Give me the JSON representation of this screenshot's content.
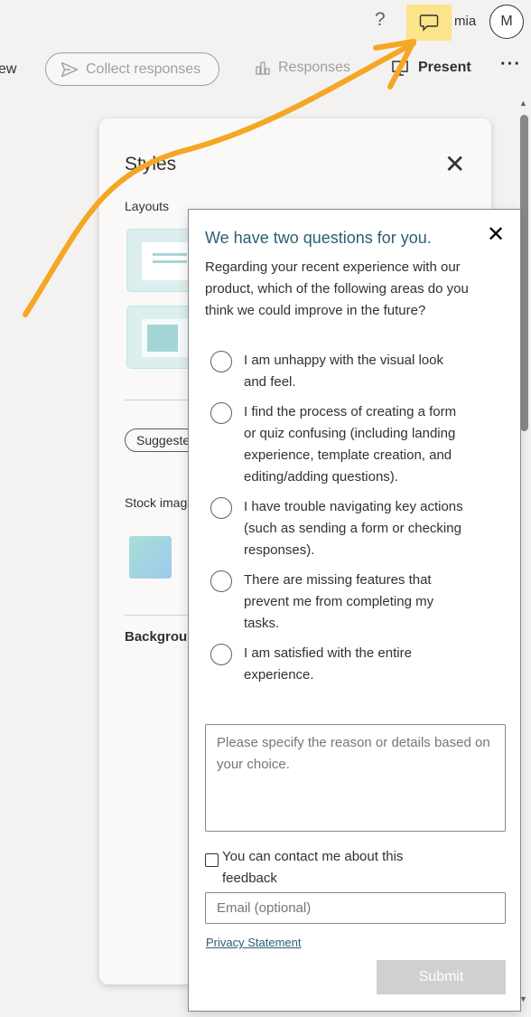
{
  "topbar": {
    "help_icon": "?",
    "feedback_icon": "chat-bubble-icon",
    "user_name": "mia",
    "avatar_initial": "M",
    "highlight_color": "#fbe48a"
  },
  "toolbar": {
    "view_label": "ew",
    "collect_label": "Collect responses",
    "responses_label": "Responses",
    "present_label": "Present",
    "more_label": "···"
  },
  "styles_panel": {
    "title": "Styles",
    "layouts_label": "Layouts",
    "suggested_label": "Suggested",
    "stock_label": "Stock images",
    "background_label": "Background"
  },
  "dialog": {
    "title": "We have two questions for you.",
    "question": "Regarding your recent experience with our product, which of the following areas do you think we could improve in the future?",
    "options": [
      "I am unhappy with the visual look and feel.",
      "I find the process of creating a form or quiz confusing (including landing experience, template creation, and editing/adding questions).",
      "I have trouble navigating key actions (such as sending a form or checking responses).",
      "There are missing features that prevent me from completing my tasks.",
      "I am satisfied with the entire experience."
    ],
    "details_placeholder": "Please specify the reason or details based on your choice.",
    "contact_label": "You can contact me about this feedback",
    "email_placeholder": "Email (optional)",
    "privacy_label": "Privacy Statement",
    "submit_label": "Submit",
    "title_color": "#2b5f75"
  },
  "annotation": {
    "arrow_color": "#f5a623"
  }
}
